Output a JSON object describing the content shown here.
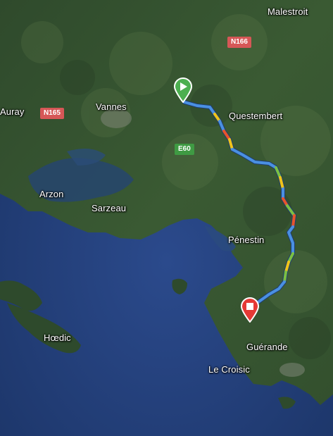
{
  "map": {
    "places": {
      "malestroit": "Malestroit",
      "auray": "Auray",
      "vannes": "Vannes",
      "questembert": "Questembert",
      "arzon": "Arzon",
      "sarzeau": "Sarzeau",
      "penestin": "Pénestin",
      "hoedic": "Hœdic",
      "guerande": "Guérande",
      "le_croisic": "Le Croisic"
    },
    "road_shields": {
      "n166": "N166",
      "n165": "N165",
      "e60": "E60"
    },
    "markers": {
      "start_icon": "play-icon",
      "end_icon": "stop-icon",
      "start_color": "#4caf50",
      "end_color": "#e53935"
    },
    "route": {
      "traffic_colors": {
        "free": "#4a90e2",
        "moderate": "#f0c419",
        "slow": "#e8542c"
      }
    }
  }
}
